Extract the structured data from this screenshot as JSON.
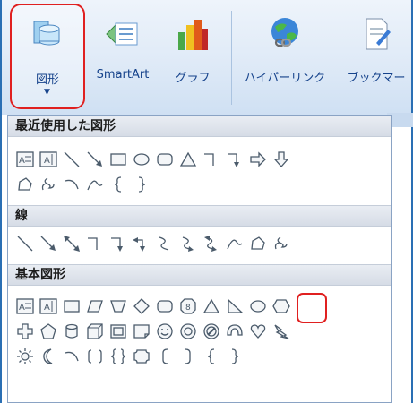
{
  "ribbon": {
    "shapes_label": "図形",
    "smartart_label": "SmartArt",
    "graph_label": "グラフ",
    "hyperlink_label": "ハイパーリンク",
    "bookmark_label": "ブックマー"
  },
  "gallery": {
    "sections": [
      {
        "title": "最近使用した図形"
      },
      {
        "title": "線"
      },
      {
        "title": "基本図形"
      }
    ],
    "recent_row1": [
      "text-box-icon",
      "vertical-text-box-icon",
      "line-icon",
      "arrow-line-icon",
      "rectangle-icon",
      "oval-icon",
      "rounded-rectangle-icon",
      "triangle-icon",
      "elbow-connector-icon",
      "elbow-arrow-connector-icon",
      "right-arrow-icon",
      "down-arrow-icon"
    ],
    "recent_row2": [
      "freeform-icon",
      "scribble-icon",
      "arc-icon",
      "curve-icon",
      "left-brace-icon",
      "right-brace-icon"
    ],
    "lines_row": [
      "line-icon",
      "arrow-line-icon",
      "double-arrow-line-icon",
      "elbow-connector-icon",
      "elbow-arrow-connector-icon",
      "elbow-double-arrow-icon",
      "curved-connector-icon",
      "curved-arrow-connector-icon",
      "curved-double-arrow-icon",
      "curve-icon",
      "freeform-icon",
      "scribble-icon"
    ],
    "basic_row1": [
      "text-box-icon",
      "vertical-text-box-icon",
      "rectangle-icon",
      "parallelogram-icon",
      "trapezoid-icon",
      "diamond-icon",
      "rounded-rectangle-icon",
      "octagon-icon",
      "isosceles-triangle-icon",
      "right-triangle-icon",
      "oval-icon",
      "hexagon-icon"
    ],
    "basic_row2": [
      "cross-icon",
      "pentagon-icon",
      "can-icon",
      "cube-icon",
      "bevel-icon",
      "folded-corner-icon",
      "smiley-face-icon",
      "donut-icon",
      "no-symbol-icon",
      "block-arc-icon",
      "heart-icon",
      "lightning-bolt-icon"
    ],
    "basic_row3": [
      "sun-icon",
      "moon-icon",
      "arc-icon",
      "double-bracket-icon",
      "double-brace-icon",
      "plaque-icon",
      "left-bracket-icon",
      "right-bracket-icon",
      "left-brace-icon",
      "right-brace-icon"
    ]
  }
}
